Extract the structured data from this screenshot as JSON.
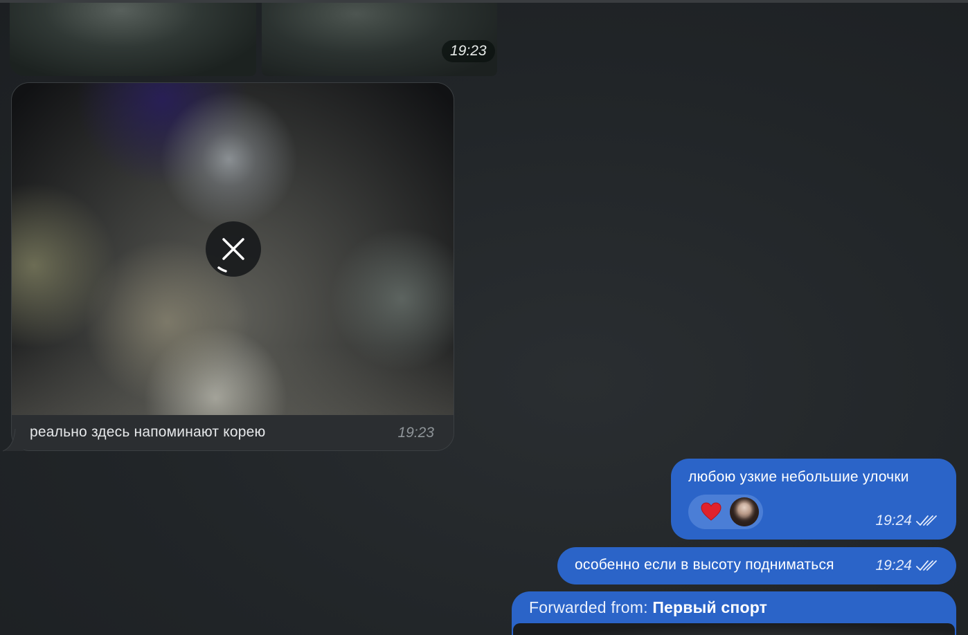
{
  "media_group": {
    "time": "19:23"
  },
  "incoming_photo": {
    "caption": "реально здесь напоминают корею",
    "time": "19:23",
    "cancel_icon": "close-icon"
  },
  "outgoing": [
    {
      "text": "любою узкие небольшие улочки",
      "time": "19:24",
      "status_icon": "double-check-icon",
      "reaction": "heart-icon",
      "reactor": "avatar"
    },
    {
      "text": "особенно если в высоту подниматься",
      "time": "19:24",
      "status_icon": "double-check-icon"
    },
    {
      "forward_label": "Forwarded from: ",
      "forward_source": "Первый спорт"
    }
  ],
  "colors": {
    "outgoing_bubble": "#2b64c8",
    "incoming_bubble": "#2b2e31",
    "background": "#1f2326"
  }
}
